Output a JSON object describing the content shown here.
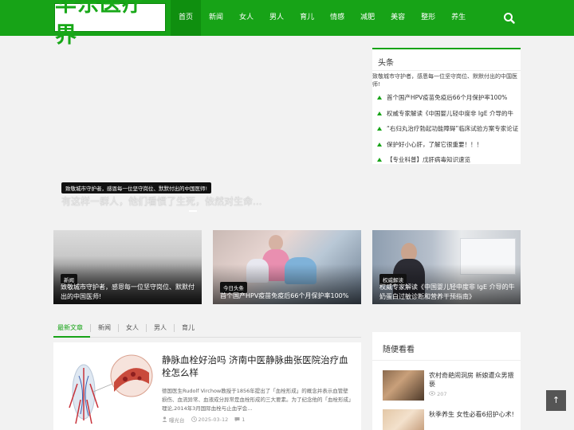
{
  "header": {
    "logo_text": "华东医疗界",
    "nav": [
      "首页",
      "新闻",
      "女人",
      "男人",
      "育儿",
      "情感",
      "减肥",
      "美容",
      "整形",
      "养生"
    ],
    "search_icon": "search-icon"
  },
  "hero": {
    "tag": "致敬城市守护者，感恩每一位坚守岗位、默默付出的中国医师!",
    "title": "有这样一群人，他们看惯了生死，依然对生命..."
  },
  "headline": {
    "title": "头条",
    "image_alt": "致敬城市守护者，感恩每一位坚守岗位、默默付出的中国医师!",
    "items": [
      "首个国产HPV疫苗免疫后66个月保护率100%",
      "权威专家解读《中国婴儿轻中度非 IgE 介导的牛",
      "“右归丸治疗勃起功能障碍”临床试验方案专家论证",
      "保护好小心肝，了解它很重要！！！",
      "【专业科普】戊肝病毒知识速览"
    ]
  },
  "cards": [
    {
      "tag": "新闻",
      "title": "致敬城市守护者，感恩每一位坚守岗位、默默付出的中国医师!"
    },
    {
      "tag": "今日头条",
      "title": "首个国产HPV疫苗免疫后66个月保护率100%"
    },
    {
      "tag": "权威解读",
      "title": "权威专家解读《中国婴儿轻中度非 IgE 介导的牛奶蛋白过敏诊断和营养干预指南》"
    }
  ],
  "tabs": [
    "最新文章",
    "新闻",
    "女人",
    "男人",
    "育儿"
  ],
  "article": {
    "title": "静脉血栓好治吗 济南中医静脉曲张医院治疗血栓怎么样",
    "summary": "德国医生Rudolf Virchow教授于1856年提出了「血栓形成」的概念并表示血管壁损伤、血流异常、血液成分异常是血栓形成的三大要素。为了纪念他的「血栓形成」理论,2014年3月国际血栓与止血学会...",
    "author": "曝光台",
    "date": "2025-03-12",
    "comments": "1"
  },
  "sidebar": {
    "title": "随便看看",
    "items": [
      {
        "title": "农村奇葩闹洞房 新娘遭众男猥亵",
        "views": "207"
      },
      {
        "title": "秋季养生 女性必看6招护心术!",
        "views": ""
      }
    ]
  },
  "back_top": "↑"
}
